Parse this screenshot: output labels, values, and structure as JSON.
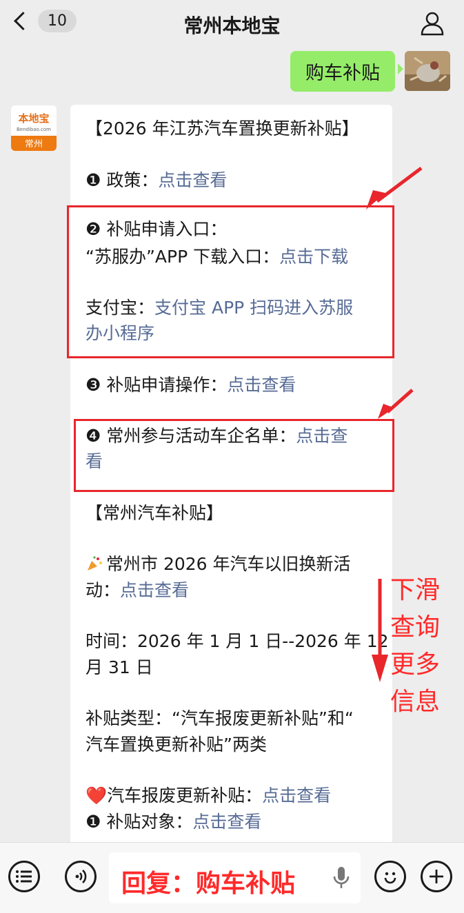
{
  "header": {
    "back_count": "10",
    "title": "常州本地宝"
  },
  "outgoing": {
    "text": "购车补贴"
  },
  "account_logo": {
    "brand": "本地宝",
    "domain": "Bendibao.com",
    "city": "常州"
  },
  "message": {
    "l1": "【2026 年江苏汽车置换更新补贴】",
    "l2_pre": "❶ 政策：",
    "l2_link": "点击查看",
    "l3": "❷ 补贴申请入口：",
    "l4_pre": "“苏服办”APP 下载入口：",
    "l4_link": "点击下载",
    "l5_pre": "支付宝：",
    "l5_link": "支付宝 APP 扫码进入苏服",
    "l6_link": "办小程序",
    "l7_pre": "❸ 补贴申请操作：",
    "l7_link": "点击查看",
    "l8_pre": "❹ 常州参与活动车企名单：",
    "l8_link": "点击查",
    "l9_link": "看",
    "l10": "【常州汽车补贴】",
    "l11_pre": "常州市 2026 年汽车以旧换新活",
    "l12_pre": "动：",
    "l12_link": "点击查看",
    "l13": "时间：2026 年 1 月 1 日--2026 年 12",
    "l14": "月 31 日",
    "l15": "补贴类型：“汽车报废更新补贴”和“",
    "l16": "汽车置换更新补贴”两类",
    "l17_pre": "❤️汽车报废更新补贴：",
    "l17_link": "点击查看",
    "l18_pre": "❶ 补贴对象：",
    "l18_link": "点击查看"
  },
  "annotation": {
    "text": "下滑查询更多信息"
  },
  "input": {
    "text": "回复：购车补贴"
  },
  "colors": {
    "link": "#576b95",
    "annotation_red": "#e8262c",
    "bubble_green": "#95ec69"
  }
}
